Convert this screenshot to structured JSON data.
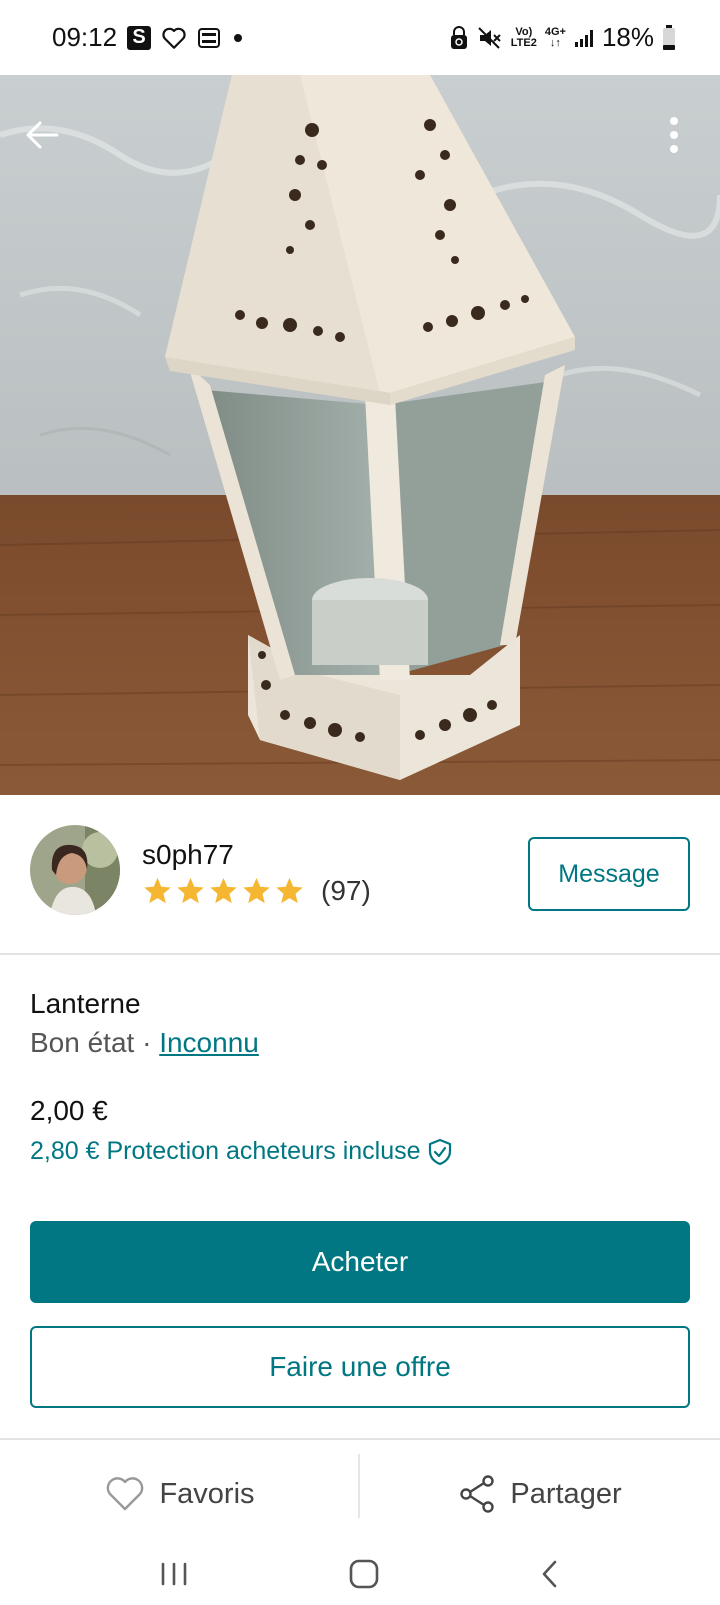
{
  "status_bar": {
    "time": "09:12",
    "s_badge": "S",
    "network_top": "Vo)",
    "network_bottom": "LTE2",
    "data_type": "4G+",
    "battery": "18%"
  },
  "seller": {
    "username": "s0ph77",
    "rating_stars": 5,
    "rating_count": "(97)",
    "message_label": "Message"
  },
  "item": {
    "title": "Lanterne",
    "condition": "Bon état",
    "separator": " · ",
    "brand": "Inconnu",
    "price": "2,00 €",
    "protection_text": "2,80 € Protection acheteurs incluse"
  },
  "buttons": {
    "buy": "Acheter",
    "offer": "Faire une offre"
  },
  "actions": {
    "favorite": "Favoris",
    "share": "Partager"
  },
  "colors": {
    "brand": "#007782",
    "star": "#f5b731"
  }
}
